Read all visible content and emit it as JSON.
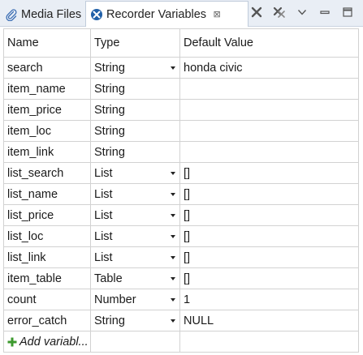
{
  "tabs": [
    {
      "label": "Media Files",
      "icon": "paperclip-icon",
      "active": false
    },
    {
      "label": "Recorder Variables",
      "icon": "recorder-variables-icon",
      "active": true,
      "close": "⊠"
    }
  ],
  "toolbar": {
    "icons": [
      "close-x-icon",
      "close-all-icon",
      "view-menu-chevron-icon",
      "minimize-icon",
      "maximize-icon"
    ]
  },
  "table": {
    "columns": [
      "Name",
      "Type",
      "Default Value"
    ],
    "rows": [
      {
        "name": "search",
        "type": "String",
        "has_dropdown": true,
        "default": "honda civic"
      },
      {
        "name": "item_name",
        "type": "String",
        "has_dropdown": false,
        "default": ""
      },
      {
        "name": "item_price",
        "type": "String",
        "has_dropdown": false,
        "default": ""
      },
      {
        "name": "item_loc",
        "type": "String",
        "has_dropdown": false,
        "default": ""
      },
      {
        "name": "item_link",
        "type": "String",
        "has_dropdown": false,
        "default": ""
      },
      {
        "name": "list_search",
        "type": "List",
        "has_dropdown": true,
        "default": "[]"
      },
      {
        "name": "list_name",
        "type": "List",
        "has_dropdown": true,
        "default": "[]"
      },
      {
        "name": "list_price",
        "type": "List",
        "has_dropdown": true,
        "default": "[]"
      },
      {
        "name": "list_loc",
        "type": "List",
        "has_dropdown": true,
        "default": "[]"
      },
      {
        "name": "list_link",
        "type": "List",
        "has_dropdown": true,
        "default": "[]"
      },
      {
        "name": "item_table",
        "type": "Table",
        "has_dropdown": true,
        "default": "[]"
      },
      {
        "name": "count",
        "type": "Number",
        "has_dropdown": true,
        "default": "1"
      },
      {
        "name": "error_catch",
        "type": "String",
        "has_dropdown": true,
        "default": "NULL"
      }
    ],
    "add_label": "Add variabl..."
  },
  "colors": {
    "tabbar_bg": "#e9eef5",
    "grid_border": "#d2d2d2",
    "add_plus": "#3c9a2e",
    "recorder_icon": "#1f5fa8"
  }
}
